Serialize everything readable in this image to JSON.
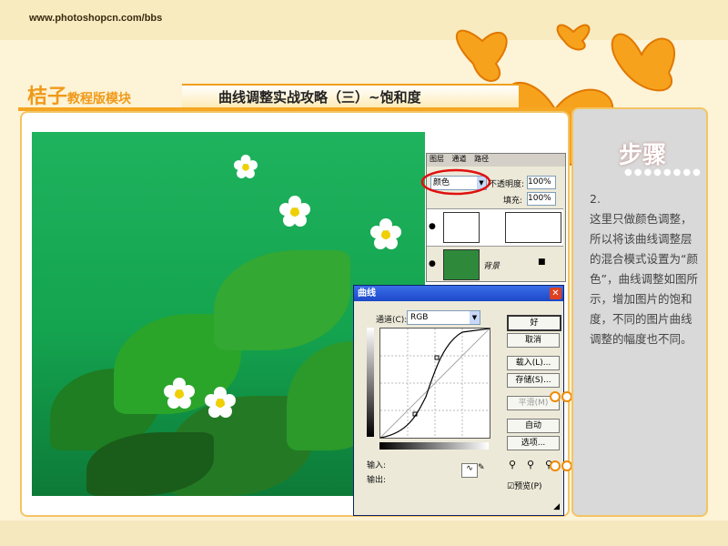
{
  "header": {
    "site_url": "www.photoshopcn.com/bbs",
    "brand_main": "桔子",
    "brand_sub": "教程版模块",
    "page_title": "曲线调整实战攻略（三）~饱和度"
  },
  "sidebar": {
    "badge": "步骤",
    "step_number": "2.",
    "step_text": "这里只做颜色调整，所以将该曲线调整层的混合模式设置为“颜色”，曲线调整如图所示，增加图片的饱和度，不同的图片曲线调整的幅度也不同。"
  },
  "layers_panel": {
    "tabs": [
      "图层",
      "通道",
      "路径"
    ],
    "blend_mode": "颜色",
    "opacity_label": "不透明度:",
    "opacity_value": "100%",
    "fill_label": "填充:",
    "fill_value": "100%",
    "background_layer": "背景"
  },
  "curves_dialog": {
    "title": "曲线",
    "channel_label": "通道(C):",
    "channel_value": "RGB",
    "ok": "好",
    "cancel": "取消",
    "load": "载入(L)...",
    "save": "存储(S)...",
    "smooth": "平滑(M)",
    "auto": "自动",
    "options": "选项...",
    "input_label": "输入:",
    "output_label": "输出:",
    "preview": "预览(P)"
  },
  "colors": {
    "accent": "#f5a623",
    "photo_green": "#1fb35e"
  }
}
